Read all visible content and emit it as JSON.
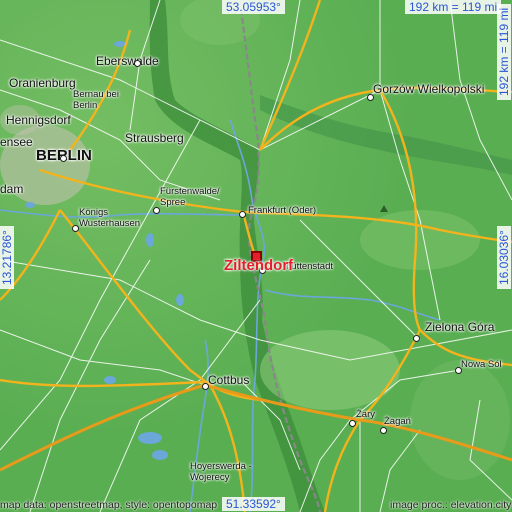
{
  "map": {
    "target": "Ziltendorf",
    "places": [
      {
        "id": "eberswalde",
        "label": "Eberswalde"
      },
      {
        "id": "oranienburg",
        "label": "Oranienburg"
      },
      {
        "id": "bernau",
        "label": "Bernau bei\nBerlin"
      },
      {
        "id": "hennigsdorf",
        "label": "Hennigsdorf"
      },
      {
        "id": "strausberg",
        "label": "Strausberg"
      },
      {
        "id": "berlin",
        "label": "BERLIN"
      },
      {
        "id": "dam",
        "label": "dam"
      },
      {
        "id": "ensee",
        "label": "ensee"
      },
      {
        "id": "furstenwalde",
        "label": "Fürstenwalde/\nSpree"
      },
      {
        "id": "konigs",
        "label": "Königs\nWusterhausen"
      },
      {
        "id": "frankfurt",
        "label": "Frankfurt (Oder)"
      },
      {
        "id": "gorzow",
        "label": "Gorzów Wielkopolski"
      },
      {
        "id": "huttenstadt",
        "label": "hüttenstadt"
      },
      {
        "id": "zielona",
        "label": "Zielona Góra"
      },
      {
        "id": "nowasol",
        "label": "Nowa Sól"
      },
      {
        "id": "cottbus",
        "label": "Cottbus"
      },
      {
        "id": "zary",
        "label": "Żary"
      },
      {
        "id": "zagan",
        "label": "Żagań"
      },
      {
        "id": "hoyerswerda",
        "label": "Hoyerswerda -\nWojerecy"
      }
    ]
  },
  "coords": {
    "top": "53.05953°",
    "bottom": "51.33592°",
    "left": "13.21786°",
    "right": "16.03036°"
  },
  "scale": {
    "horizontal": "192 km = 119 mi",
    "vertical": "192 km = 119 mi"
  },
  "credits": {
    "left": "map data: openstreetmap, style: opentopomap",
    "right": "image proc.: elevation.city"
  },
  "colors": {
    "lowland": "#52a94d",
    "upland": "#7cc46a",
    "valley": "#3e8f3b",
    "road_major": "#f2b31c",
    "road_minor": "#ffffff",
    "river": "#6ba7d8",
    "border": "#8a8a8a",
    "target": "#e3202a",
    "coord_text": "#2c54d6"
  }
}
